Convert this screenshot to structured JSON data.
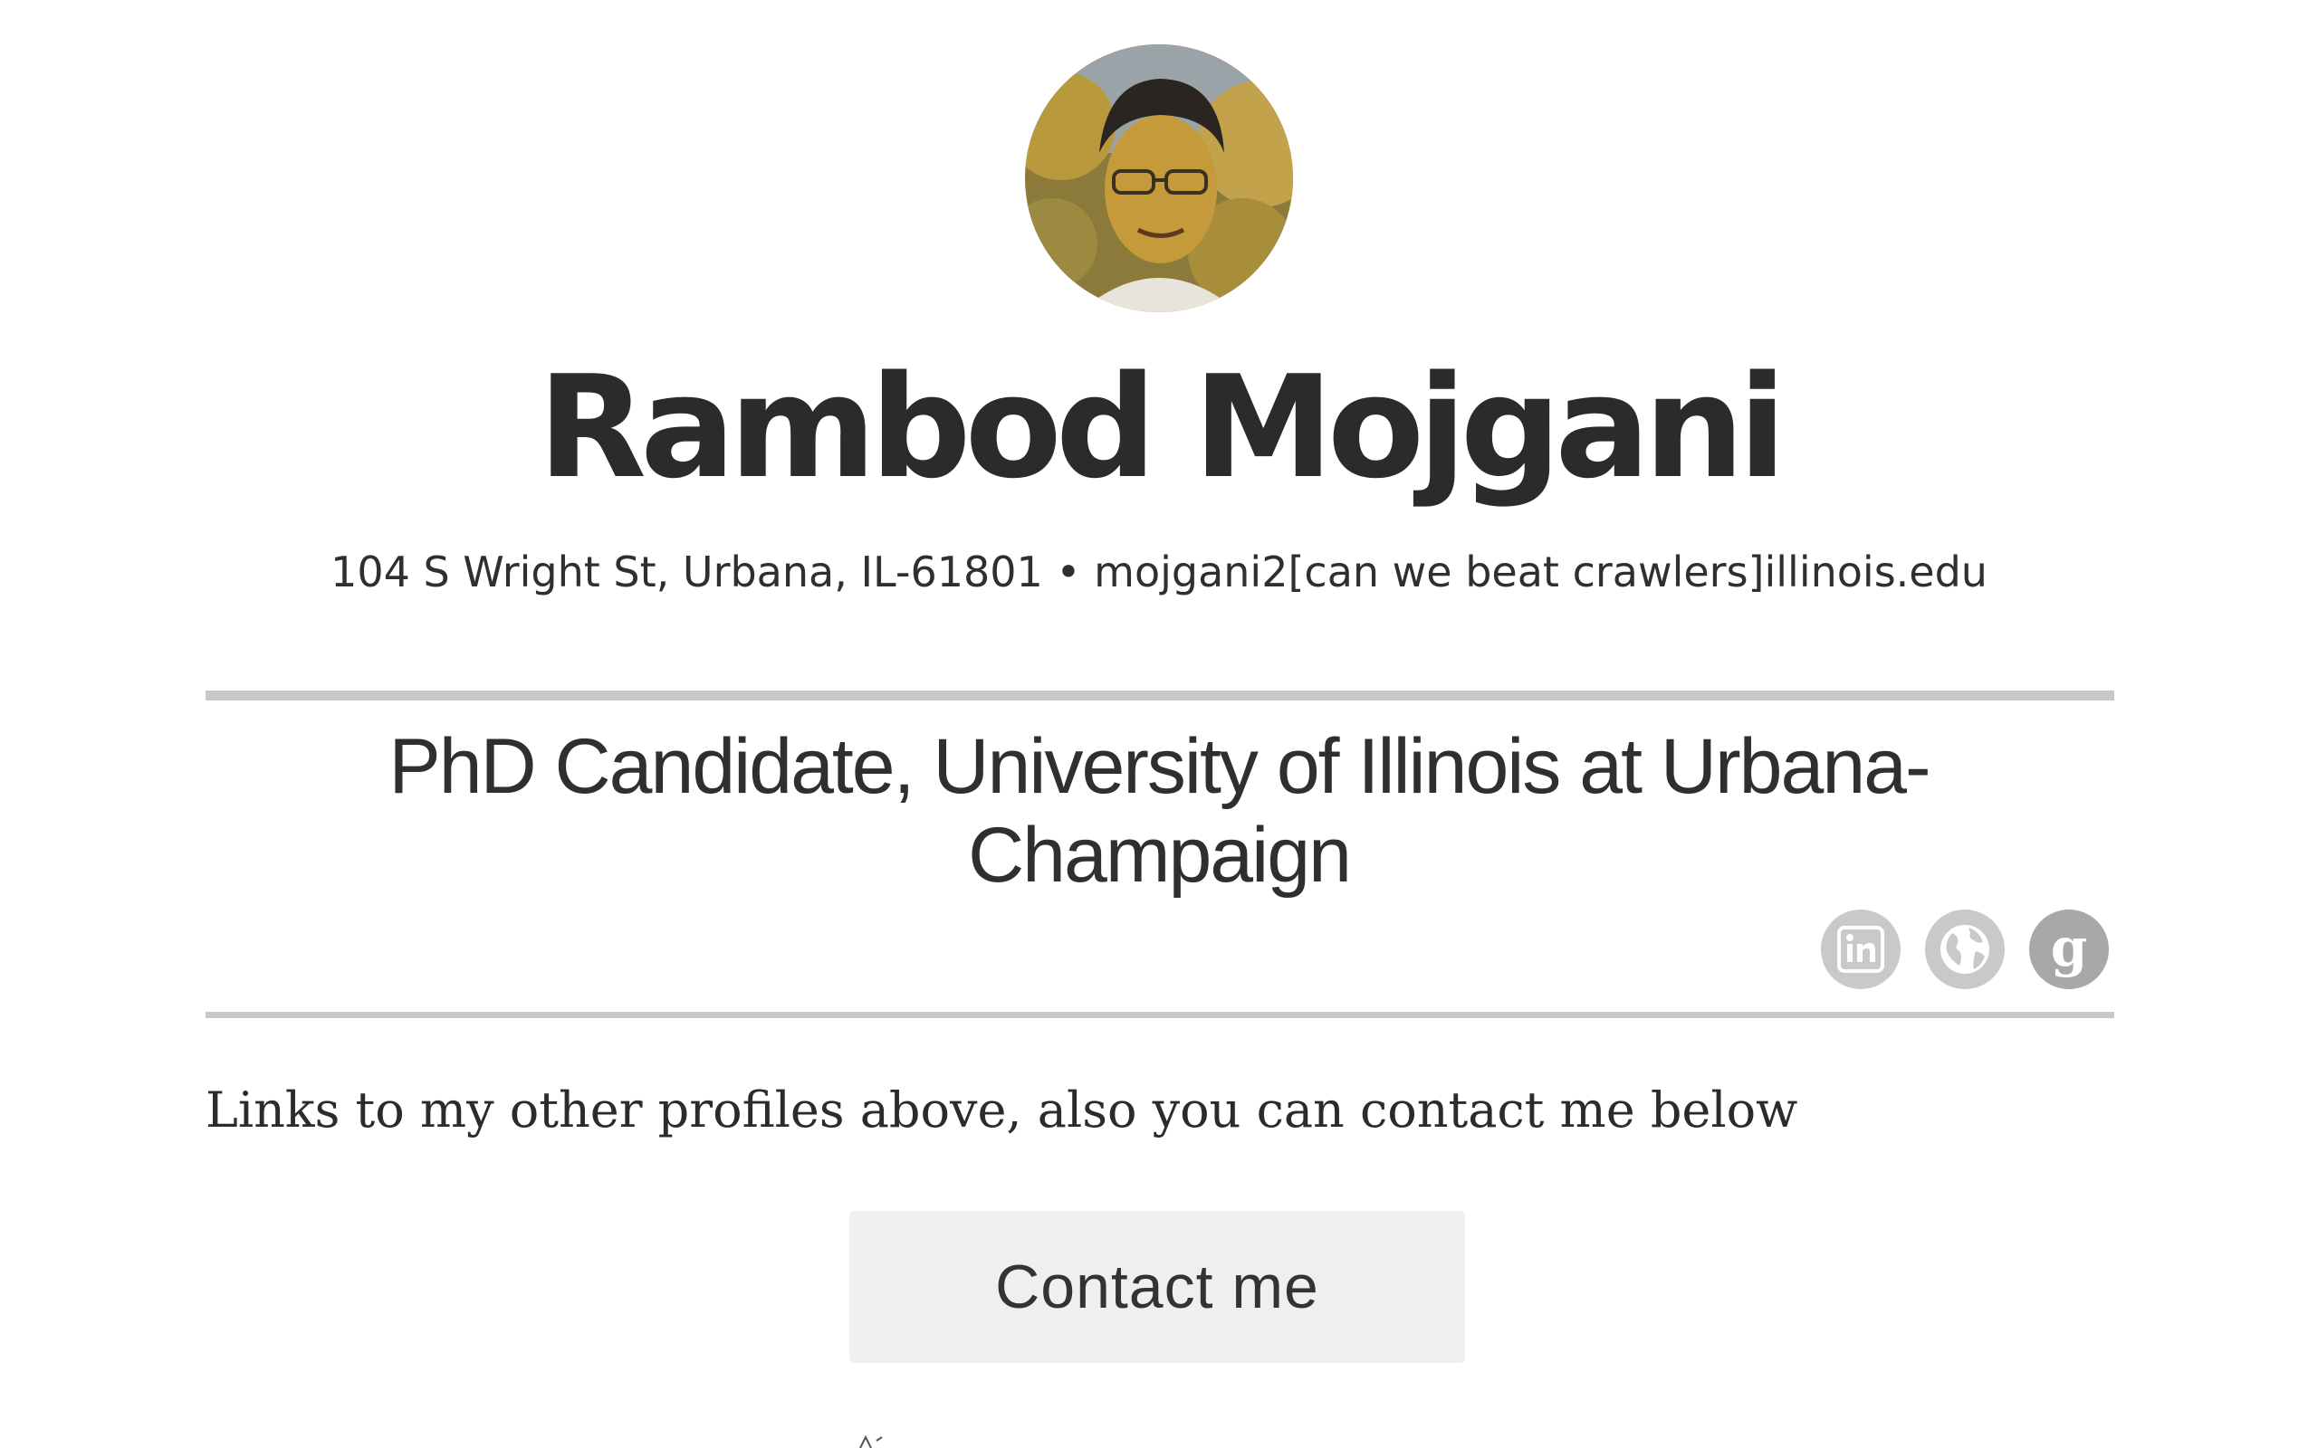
{
  "profile": {
    "name": "Rambod Mojgani",
    "avatar_alt": "profile-photo",
    "address": "104 S Wright St, Urbana, IL-61801 • mojgani2[can we beat crawlers]illinois.edu",
    "headline": "PhD Candidate, University of Illinois at Urbana-Champaign"
  },
  "social": {
    "links": [
      {
        "icon": "linkedin-icon",
        "label": "in"
      },
      {
        "icon": "globe-icon"
      },
      {
        "icon": "google-scholar-icon",
        "label": "g"
      }
    ]
  },
  "content": {
    "intro": "Links to my other profiles above, also you can contact me below",
    "contact_button": "Contact me"
  },
  "colors": {
    "text": "#2b2b2b",
    "rule": "#c8c8c8",
    "icon_bg": "#c9c9c9",
    "button_bg": "#efefef"
  }
}
